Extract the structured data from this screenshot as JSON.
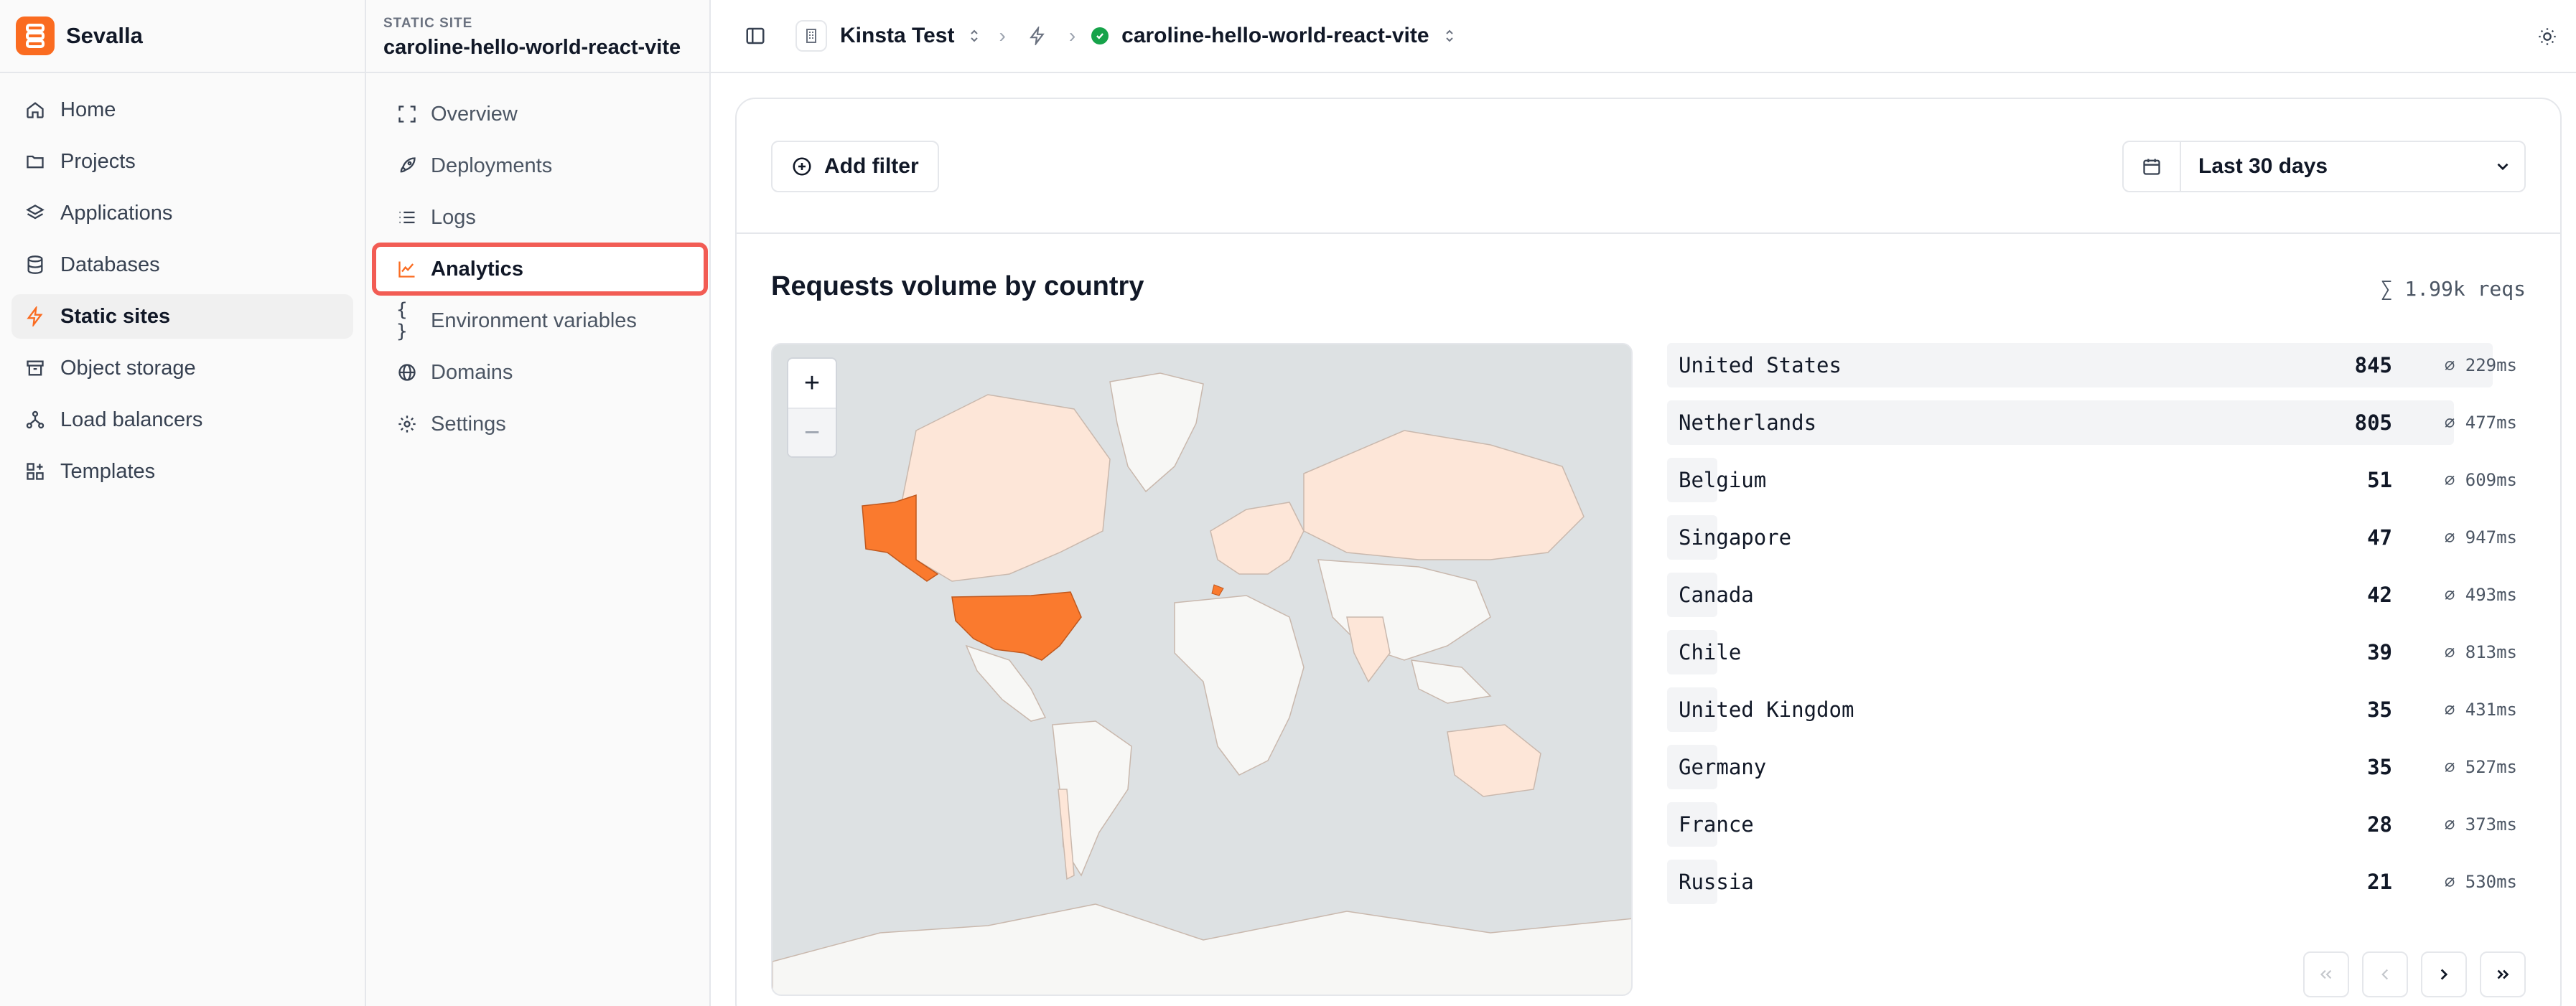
{
  "brand": {
    "name": "Sevalla"
  },
  "sidebar": {
    "items": [
      {
        "label": "Home",
        "icon": "home-icon"
      },
      {
        "label": "Projects",
        "icon": "folder-icon"
      },
      {
        "label": "Applications",
        "icon": "layers-icon"
      },
      {
        "label": "Databases",
        "icon": "database-icon"
      },
      {
        "label": "Static sites",
        "icon": "bolt-icon",
        "active": true
      },
      {
        "label": "Object storage",
        "icon": "archive-icon"
      },
      {
        "label": "Load balancers",
        "icon": "network-icon"
      },
      {
        "label": "Templates",
        "icon": "templates-icon"
      }
    ]
  },
  "site": {
    "kicker": "STATIC SITE",
    "name": "caroline-hello-world-react-vite"
  },
  "subnav": {
    "items": [
      {
        "label": "Overview"
      },
      {
        "label": "Deployments"
      },
      {
        "label": "Logs"
      },
      {
        "label": "Analytics",
        "active": true
      },
      {
        "label": "Environment variables"
      },
      {
        "label": "Domains"
      },
      {
        "label": "Settings"
      }
    ]
  },
  "topbar": {
    "company": "Kinsta Test",
    "site": "caroline-hello-world-react-vite"
  },
  "toolbar": {
    "add_filter": "Add filter",
    "date_range": "Last 30 days"
  },
  "section": {
    "title": "Requests volume by country",
    "total": "∑ 1.99k reqs"
  },
  "map": {
    "zoom_in": "+",
    "zoom_out": "−"
  },
  "countries": [
    {
      "name": "United States",
      "count": "845",
      "avg": "⌀ 229ms",
      "share": 1.0
    },
    {
      "name": "Netherlands",
      "count": "805",
      "avg": "⌀ 477ms",
      "share": 0.953
    },
    {
      "name": "Belgium",
      "count": "51",
      "avg": "⌀ 609ms",
      "share": 0.06
    },
    {
      "name": "Singapore",
      "count": "47",
      "avg": "⌀ 947ms",
      "share": 0.056
    },
    {
      "name": "Canada",
      "count": "42",
      "avg": "⌀ 493ms",
      "share": 0.05
    },
    {
      "name": "Chile",
      "count": "39",
      "avg": "⌀ 813ms",
      "share": 0.046
    },
    {
      "name": "United Kingdom",
      "count": "35",
      "avg": "⌀ 431ms",
      "share": 0.041
    },
    {
      "name": "Germany",
      "count": "35",
      "avg": "⌀ 527ms",
      "share": 0.041
    },
    {
      "name": "France",
      "count": "28",
      "avg": "⌀ 373ms",
      "share": 0.033
    },
    {
      "name": "Russia",
      "count": "21",
      "avg": "⌀ 530ms",
      "share": 0.025
    }
  ],
  "colors": {
    "accent": "#fa6b20",
    "highlight_outline": "#f25c54",
    "status_ok": "#16a34a",
    "map_water": "#dde1e3",
    "map_land_low": "#fde6d8",
    "map_land_none": "#f7f7f5"
  }
}
